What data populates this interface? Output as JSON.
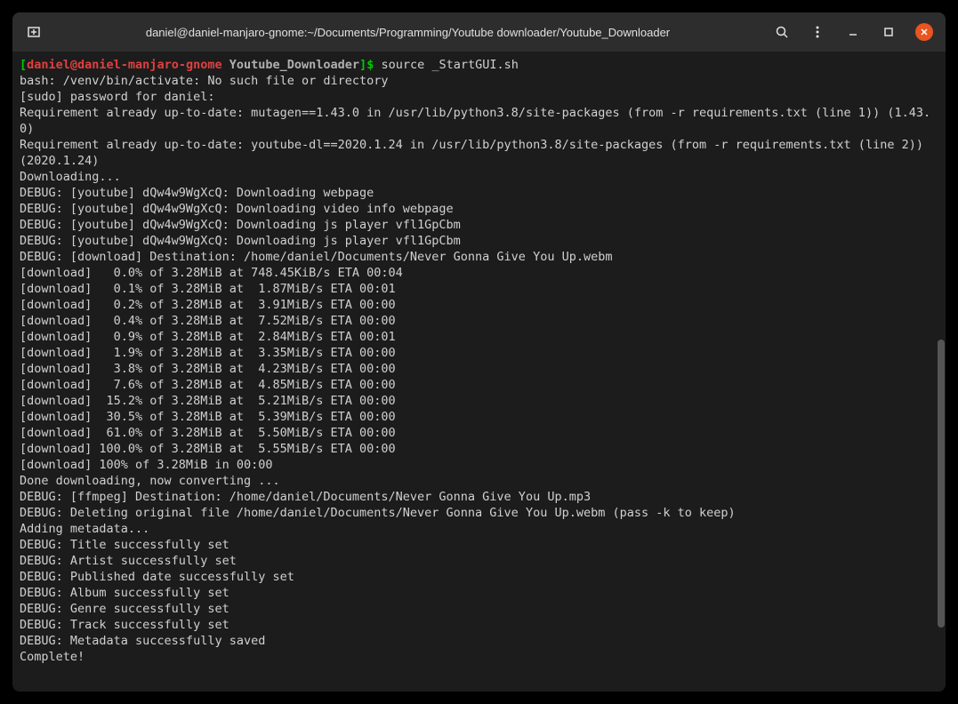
{
  "titlebar": {
    "title": "daniel@daniel-manjaro-gnome:~/Documents/Programming/Youtube downloader/Youtube_Downloader"
  },
  "prompt": {
    "user_host": "daniel@daniel-manjaro-gnome",
    "path": "Youtube_Downloader",
    "command": "source _StartGUI.sh"
  },
  "lines": [
    "bash: /venv/bin/activate: No such file or directory",
    "[sudo] password for daniel:",
    "Requirement already up-to-date: mutagen==1.43.0 in /usr/lib/python3.8/site-packages (from -r requirements.txt (line 1)) (1.43.0)",
    "Requirement already up-to-date: youtube-dl==2020.1.24 in /usr/lib/python3.8/site-packages (from -r requirements.txt (line 2)) (2020.1.24)",
    "Downloading...",
    "DEBUG: [youtube] dQw4w9WgXcQ: Downloading webpage",
    "DEBUG: [youtube] dQw4w9WgXcQ: Downloading video info webpage",
    "DEBUG: [youtube] dQw4w9WgXcQ: Downloading js player vfl1GpCbm",
    "DEBUG: [youtube] dQw4w9WgXcQ: Downloading js player vfl1GpCbm",
    "DEBUG: [download] Destination: /home/daniel/Documents/Never Gonna Give You Up.webm",
    "[download]   0.0% of 3.28MiB at 748.45KiB/s ETA 00:04",
    "[download]   0.1% of 3.28MiB at  1.87MiB/s ETA 00:01",
    "[download]   0.2% of 3.28MiB at  3.91MiB/s ETA 00:00",
    "[download]   0.4% of 3.28MiB at  7.52MiB/s ETA 00:00",
    "[download]   0.9% of 3.28MiB at  2.84MiB/s ETA 00:01",
    "[download]   1.9% of 3.28MiB at  3.35MiB/s ETA 00:00",
    "[download]   3.8% of 3.28MiB at  4.23MiB/s ETA 00:00",
    "[download]   7.6% of 3.28MiB at  4.85MiB/s ETA 00:00",
    "[download]  15.2% of 3.28MiB at  5.21MiB/s ETA 00:00",
    "[download]  30.5% of 3.28MiB at  5.39MiB/s ETA 00:00",
    "[download]  61.0% of 3.28MiB at  5.50MiB/s ETA 00:00",
    "[download] 100.0% of 3.28MiB at  5.55MiB/s ETA 00:00",
    "[download] 100% of 3.28MiB in 00:00",
    "Done downloading, now converting ...",
    "DEBUG: [ffmpeg] Destination: /home/daniel/Documents/Never Gonna Give You Up.mp3",
    "DEBUG: Deleting original file /home/daniel/Documents/Never Gonna Give You Up.webm (pass -k to keep)",
    "Adding metadata...",
    "DEBUG: Title successfully set",
    "DEBUG: Artist successfully set",
    "DEBUG: Published date successfully set",
    "DEBUG: Album successfully set",
    "DEBUG: Genre successfully set",
    "DEBUG: Track successfully set",
    "DEBUG: Metadata successfully saved",
    "Complete!"
  ]
}
